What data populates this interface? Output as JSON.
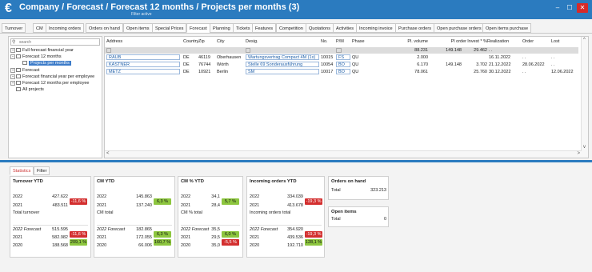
{
  "titlebar": {
    "icon": "euro-icon",
    "title": "Company / Forecast / Forecast 12 months / Projects per months (3)",
    "subtitle": "Filter active",
    "controls": {
      "minimize": "–",
      "maximize": "☐",
      "close": "✕"
    }
  },
  "tabs": [
    "Turnover",
    "CM",
    "Incoming orders",
    "Orders on hand",
    "Open items",
    "Special Prices",
    "Forecast",
    "Planning",
    "Tickets",
    "Features",
    "Competition",
    "Quotations",
    "Activities",
    "Incoming invoice",
    "Purchase orders",
    "Open purchase orders",
    "Open items purchase"
  ],
  "active_tab": "Forecast",
  "tree": {
    "search_placeholder": "search",
    "items": [
      {
        "label": "Full forecast financial year",
        "expander": "+"
      },
      {
        "label": "Forecast 12 months",
        "expander": "−"
      },
      {
        "label": "Projects per months"
      },
      {
        "label": "Forecast",
        "expander": "+"
      },
      {
        "label": "Forecast financial year per employee",
        "expander": "+"
      },
      {
        "label": "Forecast 12 months per employee",
        "expander": "+"
      },
      {
        "label": "All projects"
      }
    ]
  },
  "grid": {
    "headers": {
      "address": "Address",
      "country": "Country",
      "zip": "Zip",
      "city": "City",
      "desig": "Desig.",
      "no": "No.",
      "pm": "P/M",
      "phase": "Phase",
      "volume": "Pl. volume",
      "porder": "Pl order",
      "invest": "Invest * %",
      "realization": "Realization",
      "order": "Order",
      "lost": "Lost"
    },
    "total_row": {
      "volume": "88.231",
      "porder": "149.148",
      "invest": "29.462",
      "realization": ". ."
    },
    "rows": [
      {
        "address": "RAUB",
        "country": "DE",
        "zip": "46119",
        "city": "Oberhausen",
        "desig": "Wartungsvertrag Compact 4M (1x)",
        "no": "10015",
        "pm": "FS",
        "phase": "QU",
        "volume": "2.000",
        "porder": "",
        "invest": "",
        "realization": "16.11.2022",
        "order": ". .",
        "lost": ". ."
      },
      {
        "address": "KASTNER",
        "country": "DE",
        "zip": "76744",
        "city": "Wörth",
        "desig": "Stelle 69 Sonderausführung",
        "no": "10054",
        "pm": "BO",
        "phase": "QU",
        "volume": "6.170",
        "porder": "149.148",
        "invest": "3.702",
        "realization": "21.12.2022",
        "order": "28.06.2022",
        "lost": ". ."
      },
      {
        "address": "METZ",
        "country": "DE",
        "zip": "10921",
        "city": "Berlin",
        "desig": "SM",
        "no": "10017",
        "pm": "BO",
        "phase": "QU",
        "volume": "78.061",
        "porder": "",
        "invest": "25.760",
        "realization": "30.12.2022",
        "order": ". .",
        "lost": "12.06.2022"
      }
    ]
  },
  "bottom_tabs": [
    "Statistics",
    "Filter"
  ],
  "cards": [
    {
      "title": "Turnover YTD",
      "cur": [
        {
          "label": "2022",
          "value": "427.622"
        },
        {
          "label": "2021",
          "value": "483.511"
        }
      ],
      "cur_badge": "-11,6 %",
      "cur_badge_color": "red",
      "total_label": "Total turnover",
      "hist": [
        {
          "label": "2022 Forecast",
          "value": "515.595"
        },
        {
          "label": "2021",
          "value": "582.982"
        },
        {
          "label": "2020",
          "value": "188.568"
        }
      ],
      "hist_badges": [
        {
          "text": "-11,6 %",
          "color": "red"
        },
        {
          "text": "209,1 %",
          "color": "green"
        }
      ]
    },
    {
      "title": "CM YTD",
      "cur": [
        {
          "label": "2022",
          "value": "145.863"
        },
        {
          "label": "2021",
          "value": "137.240"
        }
      ],
      "cur_badge": "6,3 %",
      "cur_badge_color": "green",
      "total_label": "CM total",
      "hist": [
        {
          "label": "2022 Forecast",
          "value": "182.865"
        },
        {
          "label": "2021",
          "value": "172.055"
        },
        {
          "label": "2020",
          "value": "66.006"
        }
      ],
      "hist_badges": [
        {
          "text": "6,3 %",
          "color": "green"
        },
        {
          "text": "160,7 %",
          "color": "green"
        }
      ]
    },
    {
      "title": "CM % YTD",
      "cur": [
        {
          "label": "2022",
          "value": "34,1"
        },
        {
          "label": "2021",
          "value": "28,4"
        }
      ],
      "cur_badge": "5,7 %",
      "cur_badge_color": "green",
      "total_label": "CM % total",
      "hist": [
        {
          "label": "2022 Forecast",
          "value": "35,5"
        },
        {
          "label": "2021",
          "value": "29,5"
        },
        {
          "label": "2020",
          "value": "35,0"
        }
      ],
      "hist_badges": [
        {
          "text": "6,0 %",
          "color": "green"
        },
        {
          "text": "-5,5 %",
          "color": "red"
        }
      ]
    },
    {
      "title": "Incoming orders YTD",
      "cur": [
        {
          "label": "2022",
          "value": "334.039"
        },
        {
          "label": "2021",
          "value": "413.678"
        }
      ],
      "cur_badge": "-19,3 %",
      "cur_badge_color": "red",
      "total_label": "Incoming orders total",
      "hist": [
        {
          "label": "2022 Forecast",
          "value": "354.920"
        },
        {
          "label": "2021",
          "value": "439.536"
        },
        {
          "label": "2020",
          "value": "192.710"
        }
      ],
      "hist_badges": [
        {
          "text": "-19,3 %",
          "color": "red"
        },
        {
          "text": "128,1 %",
          "color": "green"
        }
      ]
    }
  ],
  "orders_on_hand": {
    "title": "Orders on hand",
    "label": "Total",
    "value": "323.213"
  },
  "open_items": {
    "title": "Open items",
    "label": "Total",
    "value": "0"
  },
  "colors": {
    "accent": "#2b7bbf",
    "positive": "#8dc63f",
    "negative": "#d32f2f",
    "selection": "#3d7cc9"
  }
}
